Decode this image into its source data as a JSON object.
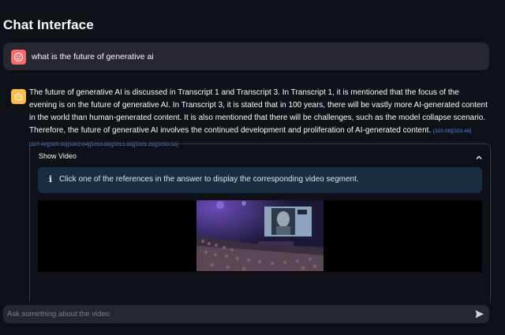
{
  "page": {
    "title": "Chat Interface"
  },
  "messages": {
    "user": {
      "text": "what is the future of generative ai"
    },
    "assistant": {
      "text": "The future of generative AI is discussed in Transcript 1 and Transcript 3. In Transcript 1, it is mentioned that the focus of the evening is on the future of generative AI. In Transcript 3, it is stated that in 100 years, there will be vastly more AI-generated content in the world than human-generated content. It is also mentioned that there will be challenges, such as the model collapse scenario. Therefore, the future of generative AI involves the continued development and proliferation of AI-generated content.",
      "references": "[320.08][323.48][327.48][369.36][5002.84][5010.88][5013.88][5021.28][5030.56]"
    }
  },
  "expander": {
    "label": "Show Video",
    "info": "Click one of the references in the answer to display the corresponding video segment."
  },
  "chat_input": {
    "placeholder": "Ask something about the video"
  },
  "icons": {
    "user_avatar": "smiley-face-icon",
    "bot_avatar": "robot-icon",
    "info": "info-icon",
    "chevron": "chevron-up-icon",
    "send": "send-icon"
  },
  "colors": {
    "background": "#0e1117",
    "surface": "#262730",
    "user_avatar": "#ff6b6b",
    "bot_avatar": "#ffbd45",
    "info_bg": "#172d43",
    "link": "#4b8bf5"
  }
}
